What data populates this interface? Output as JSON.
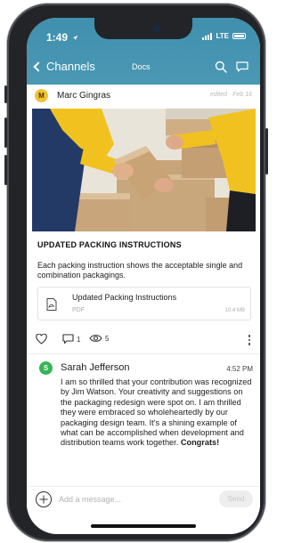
{
  "status": {
    "time": "1:49",
    "network": "LTE"
  },
  "nav": {
    "back_label": "Channels",
    "title": "Docs"
  },
  "post": {
    "author": {
      "initial": "M",
      "name": "Marc Gingras"
    },
    "edited_label": "edited · Feb 16",
    "title": "UPDATED PACKING INSTRUCTIONS",
    "description": "Each packing instruction shows the acceptable single and combination packagings.",
    "attachment": {
      "name": "Updated Packing Instructions",
      "type": "PDF",
      "size": "10.4 MB"
    },
    "comment_count": "1",
    "view_count": "5"
  },
  "reply": {
    "initial": "S",
    "name": "Sarah Jefferson",
    "time": "4:52 PM",
    "body": "I am so thrilled that your contribution was recognized by Jim Watson. Your creativity and suggestions on the packaging redesign were spot on. I am thrilled they were embraced so wholeheartedly by our packaging design team. It's a shining example of what can be accomplished when development and distribution teams work together.",
    "body_bold": "Congrats!"
  },
  "composer": {
    "placeholder": "Add a message...",
    "send_label": "Send"
  },
  "colors": {
    "header": "#4593b0",
    "author_avatar": "#f2c230",
    "reply_avatar": "#36b555"
  }
}
